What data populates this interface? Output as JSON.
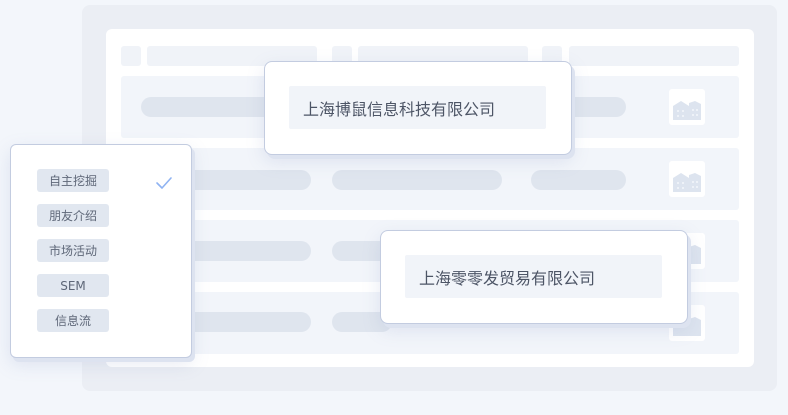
{
  "colors": {
    "page_bg": "#f3f6fb",
    "frame_bg": "#ebeef4",
    "placeholder": "#dfe5ee",
    "accent_check": "#8fb3f2",
    "text": "#4d5566"
  },
  "background_table": {
    "rows": 4,
    "row_icon": "building-icon"
  },
  "popups": [
    {
      "company": "上海博鼠信息科技有限公司"
    },
    {
      "company": "上海零零发贸易有限公司"
    }
  ],
  "source_menu": {
    "items": [
      {
        "label": "自主挖掘",
        "selected": true
      },
      {
        "label": "朋友介绍",
        "selected": false
      },
      {
        "label": "市场活动",
        "selected": false
      },
      {
        "label": "SEM",
        "selected": false
      },
      {
        "label": "信息流",
        "selected": false
      }
    ],
    "check_icon": "check-icon"
  }
}
